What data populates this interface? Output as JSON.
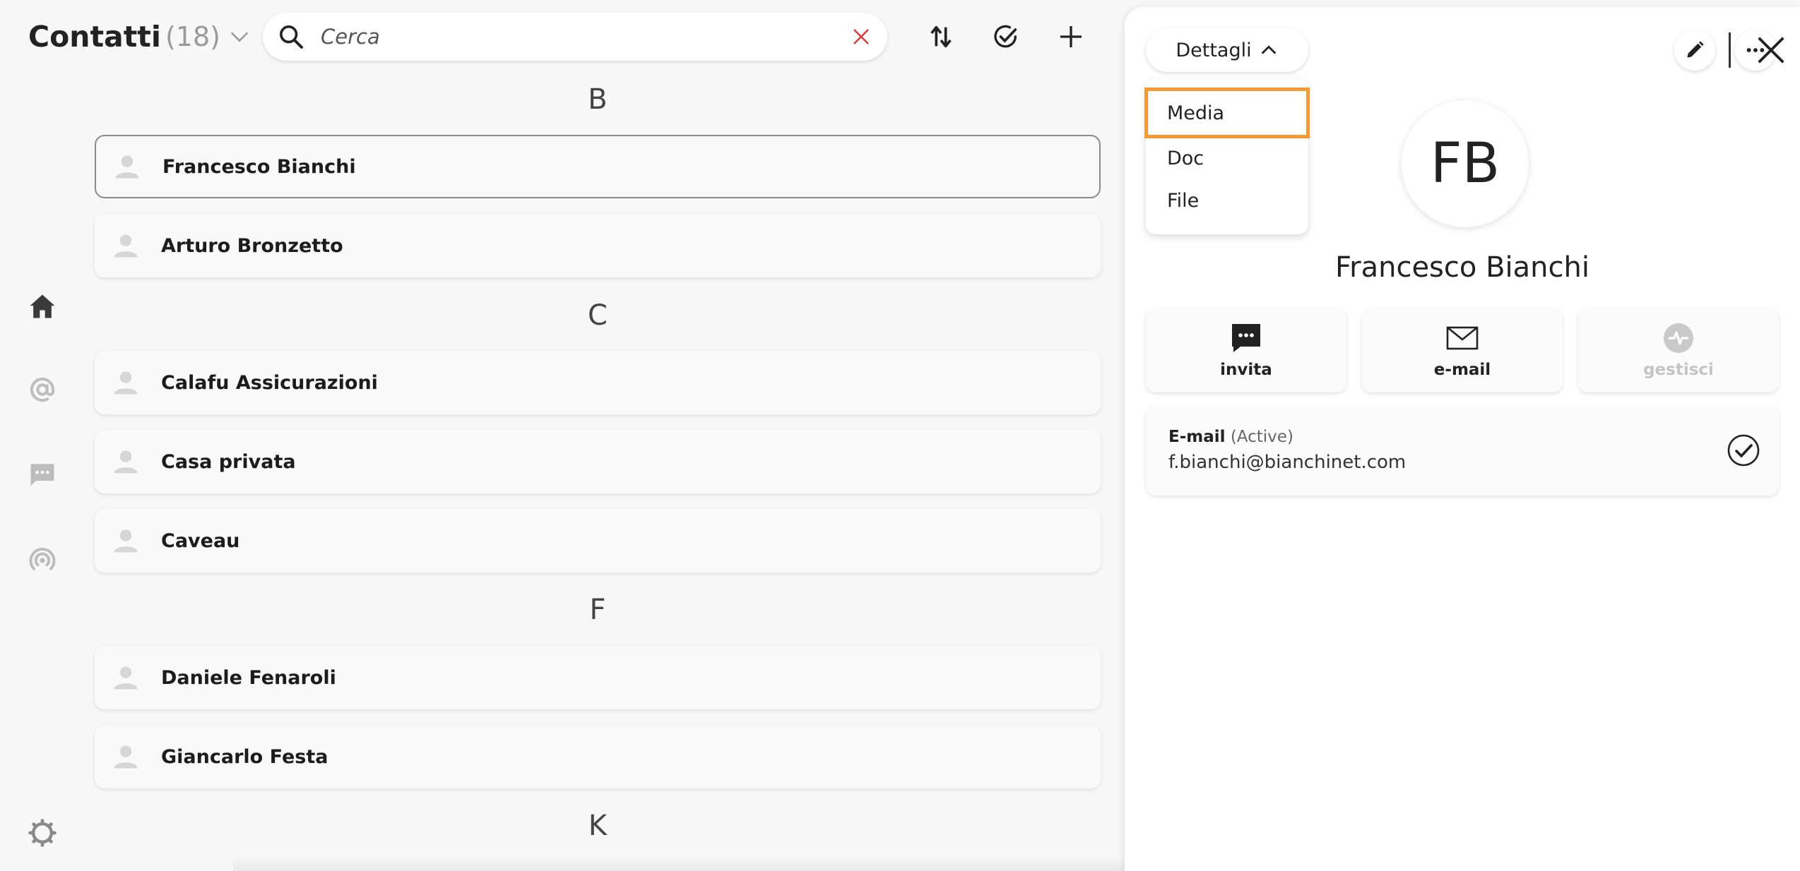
{
  "header": {
    "title": "Contatti",
    "count": "(18)",
    "search_placeholder": "Cerca"
  },
  "nav": {
    "items": [
      "home-icon",
      "at-icon",
      "chat-icon",
      "broadcast-icon"
    ],
    "settings": "gear-icon"
  },
  "list": {
    "sections": [
      {
        "letter": "B",
        "contacts": [
          "Francesco Bianchi",
          "Arturo Bronzetto"
        ]
      },
      {
        "letter": "C",
        "contacts": [
          "Calafu Assicurazioni",
          "Casa privata",
          "Caveau"
        ]
      },
      {
        "letter": "F",
        "contacts": [
          "Daniele Fenaroli",
          "Giancarlo Festa"
        ]
      },
      {
        "letter": "K",
        "contacts": []
      }
    ],
    "selected": "Francesco Bianchi"
  },
  "detail": {
    "section_button": "Dettagli",
    "menu": [
      "Media",
      "Doc",
      "File"
    ],
    "highlighted_option": "Media",
    "initials": "FB",
    "name": "Francesco Bianchi",
    "actions": [
      {
        "label": "invita",
        "icon": "chat-bubble-icon",
        "enabled": true
      },
      {
        "label": "e-mail",
        "icon": "envelope-icon",
        "enabled": true
      },
      {
        "label": "gestisci",
        "icon": "pulse-icon",
        "enabled": false
      }
    ],
    "email": {
      "label": "E-mail",
      "status": "(Active)",
      "address": "f.bianchi@bianchinet.com"
    }
  },
  "colors": {
    "highlight": "#f59a30",
    "clear_icon": "#e53935",
    "disabled": "#c4c4c4"
  }
}
